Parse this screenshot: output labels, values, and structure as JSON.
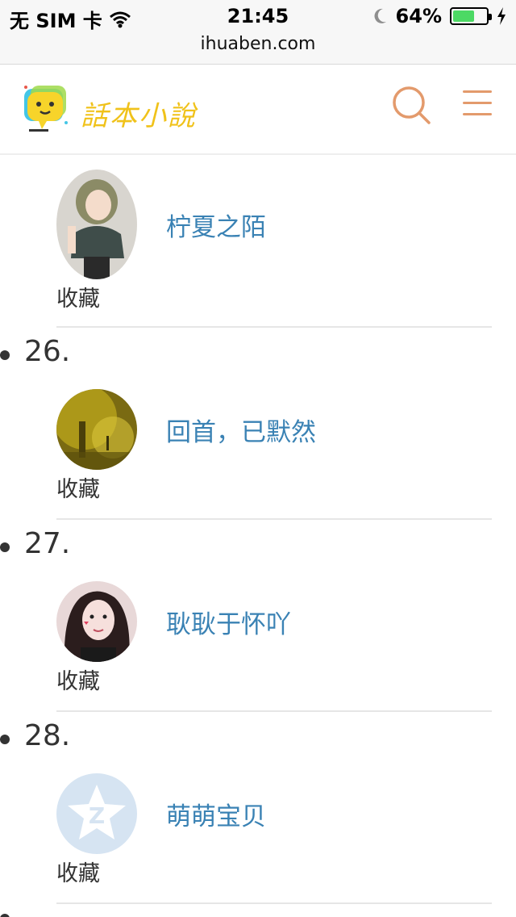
{
  "status_bar": {
    "carrier": "无 SIM 卡",
    "time": "21:45",
    "battery": "64%",
    "battery_level": 0.64
  },
  "browser": {
    "url": "ihuaben.com"
  },
  "header": {
    "logo_text": "話本小說",
    "search_icon": "search-icon",
    "menu_icon": "menu-icon",
    "accent_color": "#e39a6c",
    "logo_color": "#f0c21a"
  },
  "list": {
    "favorite_label": "收藏",
    "link_color": "#3a82b4",
    "items": [
      {
        "rank": "",
        "name": "柠夏之陌",
        "avatar": "anime-girl-avatar"
      },
      {
        "rank": "26.",
        "name": "回首，已默然",
        "avatar": "forest-scene-avatar"
      },
      {
        "rank": "27.",
        "name": "耿耿于怀吖",
        "avatar": "girl-photo-avatar"
      },
      {
        "rank": "28.",
        "name": "萌萌宝贝",
        "avatar": "qq-default-avatar"
      }
    ]
  }
}
